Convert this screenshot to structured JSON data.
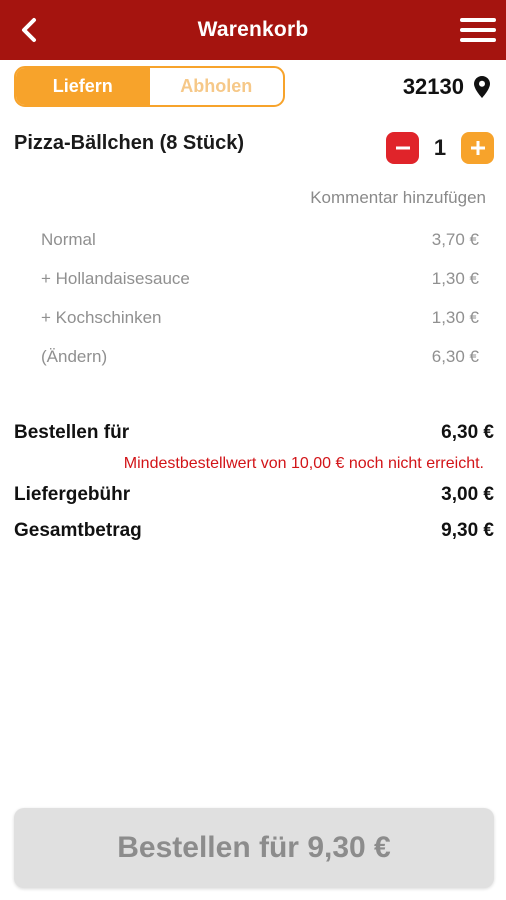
{
  "header": {
    "title": "Warenkorb",
    "back_icon": "chevron-left-icon",
    "menu_icon": "hamburger-menu-icon",
    "background": "#a5140f"
  },
  "delivery_toggle": {
    "options": [
      {
        "label": "Liefern",
        "active": true
      },
      {
        "label": "Abholen",
        "active": false
      }
    ],
    "accent": "#f7a32b"
  },
  "location": {
    "zip": "32130",
    "icon": "location-pin-icon"
  },
  "cart_item": {
    "name": "Pizza-Bällchen (8 Stück)",
    "quantity": "1",
    "minus_label": "−",
    "plus_label": "+",
    "comment_link": "Kommentar hinzufügen",
    "lines": [
      {
        "label": "Normal",
        "price": "3,70 €"
      },
      {
        "label": "+ Hollandaisesauce",
        "price": "1,30 €"
      },
      {
        "label": "+ Kochschinken",
        "price": "1,30 €"
      },
      {
        "label": "(Ändern)",
        "price": "6,30 €"
      }
    ]
  },
  "summary": {
    "subtotal_label": "Bestellen für",
    "subtotal_value": "6,30 €",
    "min_order_warning": "Mindestbestellwert von 10,00 € noch nicht erreicht.",
    "delivery_fee_label": "Liefergebühr",
    "delivery_fee_value": "3,00 €",
    "total_label": "Gesamtbetrag",
    "total_value": "9,30 €"
  },
  "order_button": {
    "label": "Bestellen für 9,30 €",
    "enabled": false
  }
}
